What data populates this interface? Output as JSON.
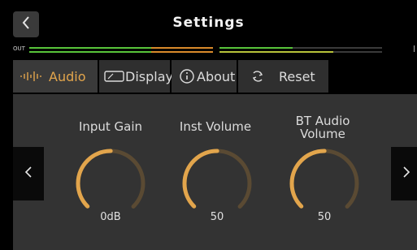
{
  "header": {
    "title": "Settings",
    "back_icon": "chevron-left-icon"
  },
  "meter": {
    "label": "OUT"
  },
  "tabs": [
    {
      "label": "Audio",
      "icon": "waveform-icon",
      "active": true
    },
    {
      "label": "Display",
      "icon": "display-icon",
      "active": false
    },
    {
      "label": "About",
      "icon": "info-icon",
      "active": false
    },
    {
      "label": "Reset",
      "icon": "refresh-icon",
      "active": false
    }
  ],
  "knobs": [
    {
      "label": "Input Gain",
      "value_text": "0dB",
      "level": 0.5
    },
    {
      "label": "Inst Volume",
      "value_text": "50",
      "level": 0.5
    },
    {
      "label": "BT Audio Volume",
      "label_line1": "BT Audio",
      "label_line2": "Volume",
      "value_text": "50",
      "level": 0.5
    }
  ],
  "nav": {
    "prev_icon": "chevron-left-icon",
    "next_icon": "chevron-right-icon"
  },
  "colors": {
    "accent": "#E2A54C",
    "knob_track": "#5A4A33",
    "meter_green": "#58C43A",
    "meter_orange": "#D98A2B",
    "meter_yellow": "#B7C23A"
  }
}
